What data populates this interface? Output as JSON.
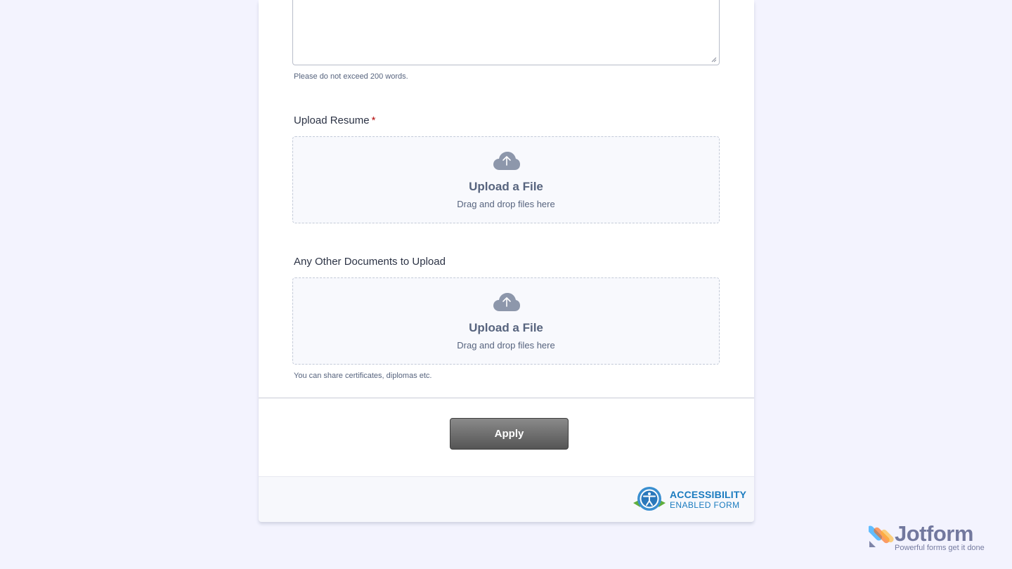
{
  "form": {
    "textarea_hint": "Please do not exceed 200 words.",
    "resume": {
      "label": "Upload Resume",
      "required_mark": "*",
      "upload_title": "Upload a File",
      "upload_sub": "Drag and drop files here"
    },
    "other_docs": {
      "label": "Any Other Documents to Upload",
      "upload_title": "Upload a File",
      "upload_sub": "Drag and drop files here",
      "hint": "You can share certificates, diplomas etc."
    },
    "submit_label": "Apply"
  },
  "footer": {
    "accessibility_line1": "ACCESSIBILITY",
    "accessibility_line2": "ENABLED FORM"
  },
  "branding": {
    "name": "Jotform",
    "tagline": "Powerful forms get it done"
  },
  "colors": {
    "page_bg": "#f3f3fe",
    "accent": "#1a7bbf",
    "required": "#b30d0d",
    "button": "#555555"
  }
}
